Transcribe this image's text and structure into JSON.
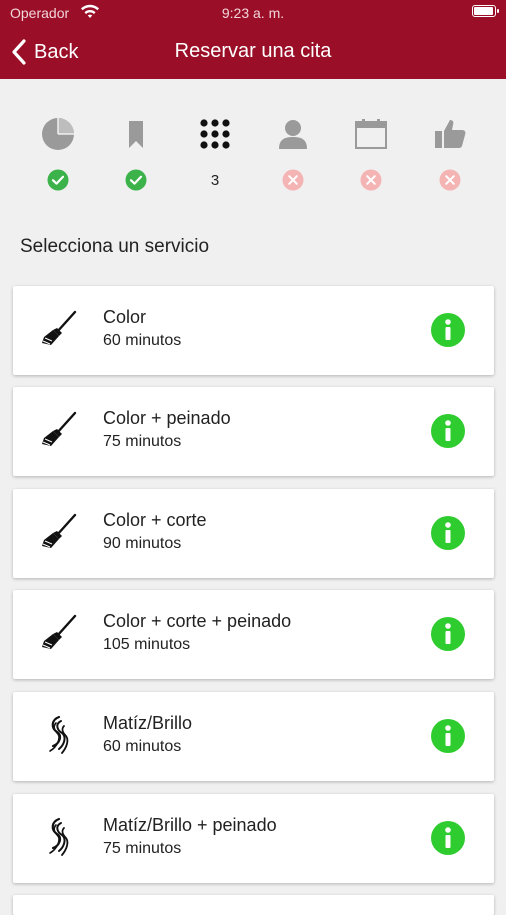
{
  "status_bar": {
    "carrier": "Operador",
    "time": "9:23 a. m.",
    "battery_level": 1.0
  },
  "nav": {
    "back_label": "Back",
    "title": "Reservar una cita"
  },
  "colors": {
    "brand": "#9a0f27",
    "ok": "#3cb34a",
    "pending": "#f4b4b4",
    "info": "#2ecc2e",
    "step_icon": "#9a9a9a"
  },
  "steps": [
    {
      "icon": "pie-chart-icon",
      "state": "done"
    },
    {
      "icon": "bookmark-icon",
      "state": "done"
    },
    {
      "icon": "grid-icon",
      "state": "current",
      "number": "3"
    },
    {
      "icon": "user-icon",
      "state": "pending"
    },
    {
      "icon": "calendar-icon",
      "state": "pending"
    },
    {
      "icon": "thumbs-up-icon",
      "state": "pending"
    }
  ],
  "heading": "Selecciona un servicio",
  "services": [
    {
      "name": "Color",
      "duration": "60 minutos",
      "icon": "brush-icon"
    },
    {
      "name": "Color + peinado",
      "duration": "75 minutos",
      "icon": "brush-icon"
    },
    {
      "name": "Color + corte",
      "duration": "90 minutos",
      "icon": "brush-icon"
    },
    {
      "name": "Color + corte + peinado",
      "duration": "105 minutos",
      "icon": "brush-icon"
    },
    {
      "name": "Matíz/Brillo",
      "duration": "60 minutos",
      "icon": "hair-icon"
    },
    {
      "name": "Matíz/Brillo + peinado",
      "duration": "75 minutos",
      "icon": "hair-icon"
    }
  ]
}
